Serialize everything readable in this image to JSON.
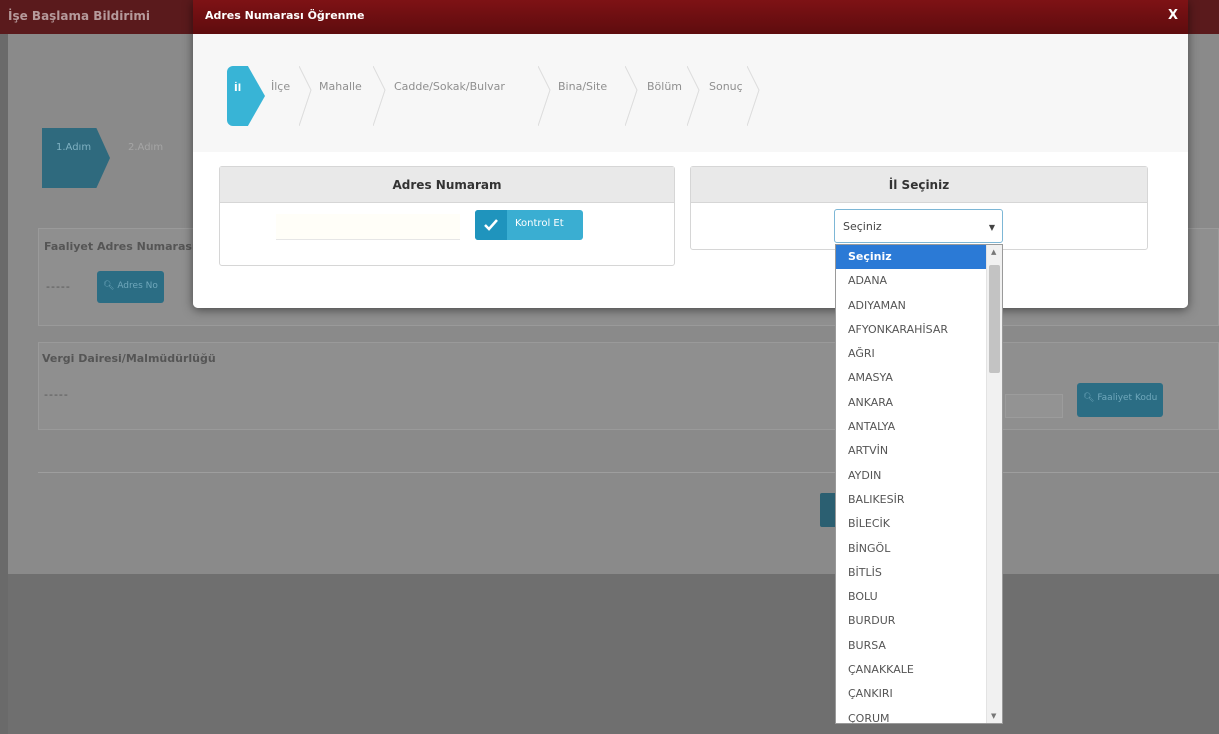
{
  "background": {
    "header_title": "İşe Başlama Bildirimi",
    "steps": [
      "1.Adım",
      "2.Adım"
    ],
    "section1_label": "Faaliyet Adres Numarası",
    "section1_value": "-----",
    "section1_button": "Adres No",
    "section2_label": "Vergi Dairesi/Malmüdürlüğü",
    "section2_value": "-----",
    "section2_button": "Faaliyet Kodu"
  },
  "modal": {
    "title": "Adres Numarası Öğrenme",
    "close_label": "X",
    "wizard": {
      "current": "İl",
      "steps": [
        "İlçe",
        "Mahalle",
        "Cadde/Sokak/Bulvar",
        "Bina/Site",
        "Bölüm",
        "Sonuç"
      ]
    },
    "address_box": {
      "header": "Adres Numaram",
      "input_value": "",
      "button_label": "Kontrol Et"
    },
    "province_box": {
      "header": "İl Seçiniz",
      "selected": "Seçiniz"
    }
  },
  "dropdown": {
    "options": [
      "Seçiniz",
      "ADANA",
      "ADIYAMAN",
      "AFYONKARAHİSAR",
      "AĞRI",
      "AMASYA",
      "ANKARA",
      "ANTALYA",
      "ARTVİN",
      "AYDIN",
      "BALIKESİR",
      "BİLECİK",
      "BİNGÖL",
      "BİTLİS",
      "BOLU",
      "BURDUR",
      "BURSA",
      "ÇANAKKALE",
      "ÇANKIRI",
      "ÇORUM"
    ],
    "selected_index": 0,
    "scroll_fraction_visible": 0.23
  },
  "colors": {
    "modal_header": "#7e1215",
    "accent": "#38b4d6",
    "selected_option": "#2b7ad6"
  }
}
